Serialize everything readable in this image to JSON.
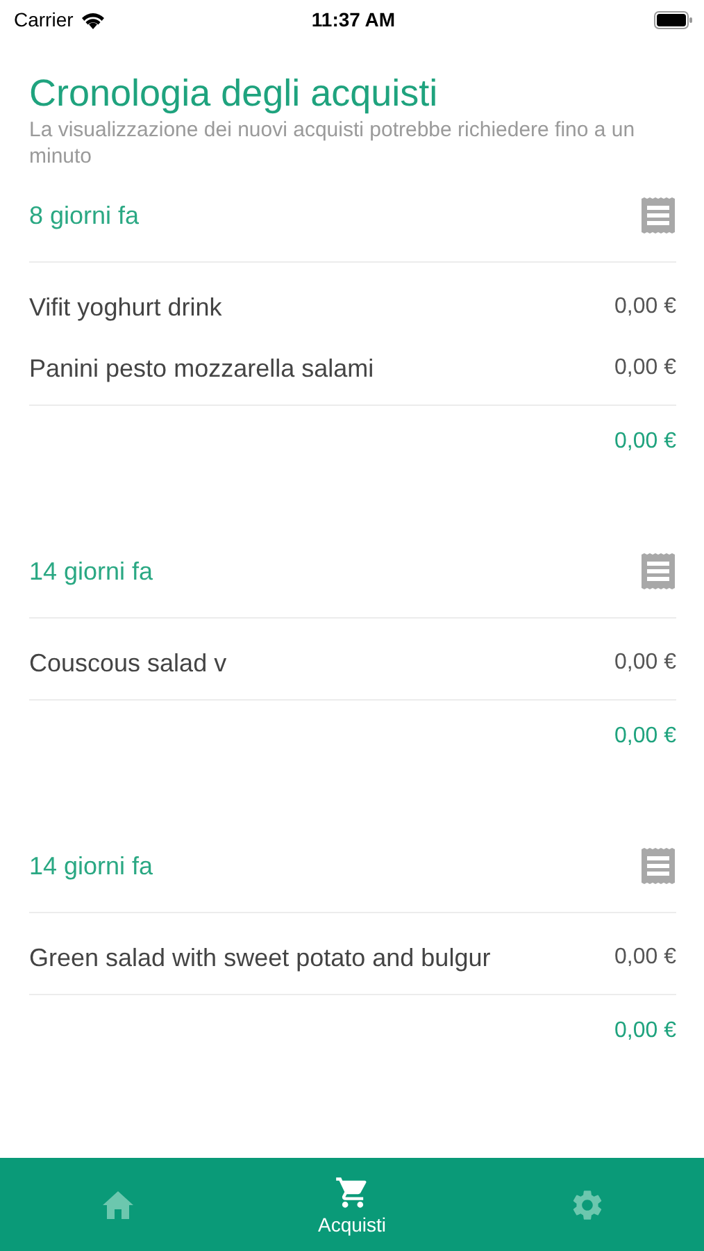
{
  "status_bar": {
    "carrier": "Carrier",
    "time": "11:37 AM"
  },
  "title": "Cronologia degli acquisti",
  "subtitle": "La visualizzazione dei nuovi acquisti potrebbe richiedere fino a un minuto",
  "purchases": [
    {
      "date": "8 giorni fa",
      "items": [
        {
          "name": "Vifit yoghurt drink",
          "price": "0,00 €"
        },
        {
          "name": "Panini pesto mozzarella salami",
          "price": "0,00 €"
        }
      ],
      "total": "0,00 €"
    },
    {
      "date": "14 giorni fa",
      "items": [
        {
          "name": "Couscous salad v",
          "price": "0,00 €"
        }
      ],
      "total": "0,00 €"
    },
    {
      "date": "14 giorni fa",
      "items": [
        {
          "name": "Green salad with sweet potato and bulgur",
          "price": "0,00 €"
        }
      ],
      "total": "0,00 €"
    }
  ],
  "tabs": [
    {
      "kind": "home",
      "selected": false
    },
    {
      "kind": "cart",
      "label": "Acquisti",
      "selected": true
    },
    {
      "kind": "settings",
      "selected": false
    }
  ]
}
